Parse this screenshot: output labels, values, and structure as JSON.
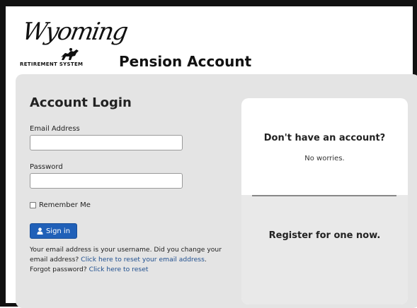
{
  "brand": {
    "logo_script": "Wyoming",
    "logo_sub": "RETIREMENT SYSTEM",
    "page_title": "Pension Account"
  },
  "login": {
    "heading": "Account Login",
    "email_label": "Email Address",
    "email_value": "",
    "password_label": "Password",
    "password_value": "",
    "remember_label": "Remember Me",
    "signin_label": "Sign in",
    "help_text_1": "Your email address is your username. Did you change your email address? ",
    "reset_email_link": "Click here to reset your email address",
    "help_text_2": ".",
    "forgot_text": "Forgot password? ",
    "reset_password_link": "Click here to reset"
  },
  "register_card": {
    "heading": "Don't have an account?",
    "subtext": "No worries.",
    "register_link": "Register for one now."
  },
  "colors": {
    "panel": "#e4e4e4",
    "button": "#2060b8",
    "link": "#1f4f8f"
  }
}
